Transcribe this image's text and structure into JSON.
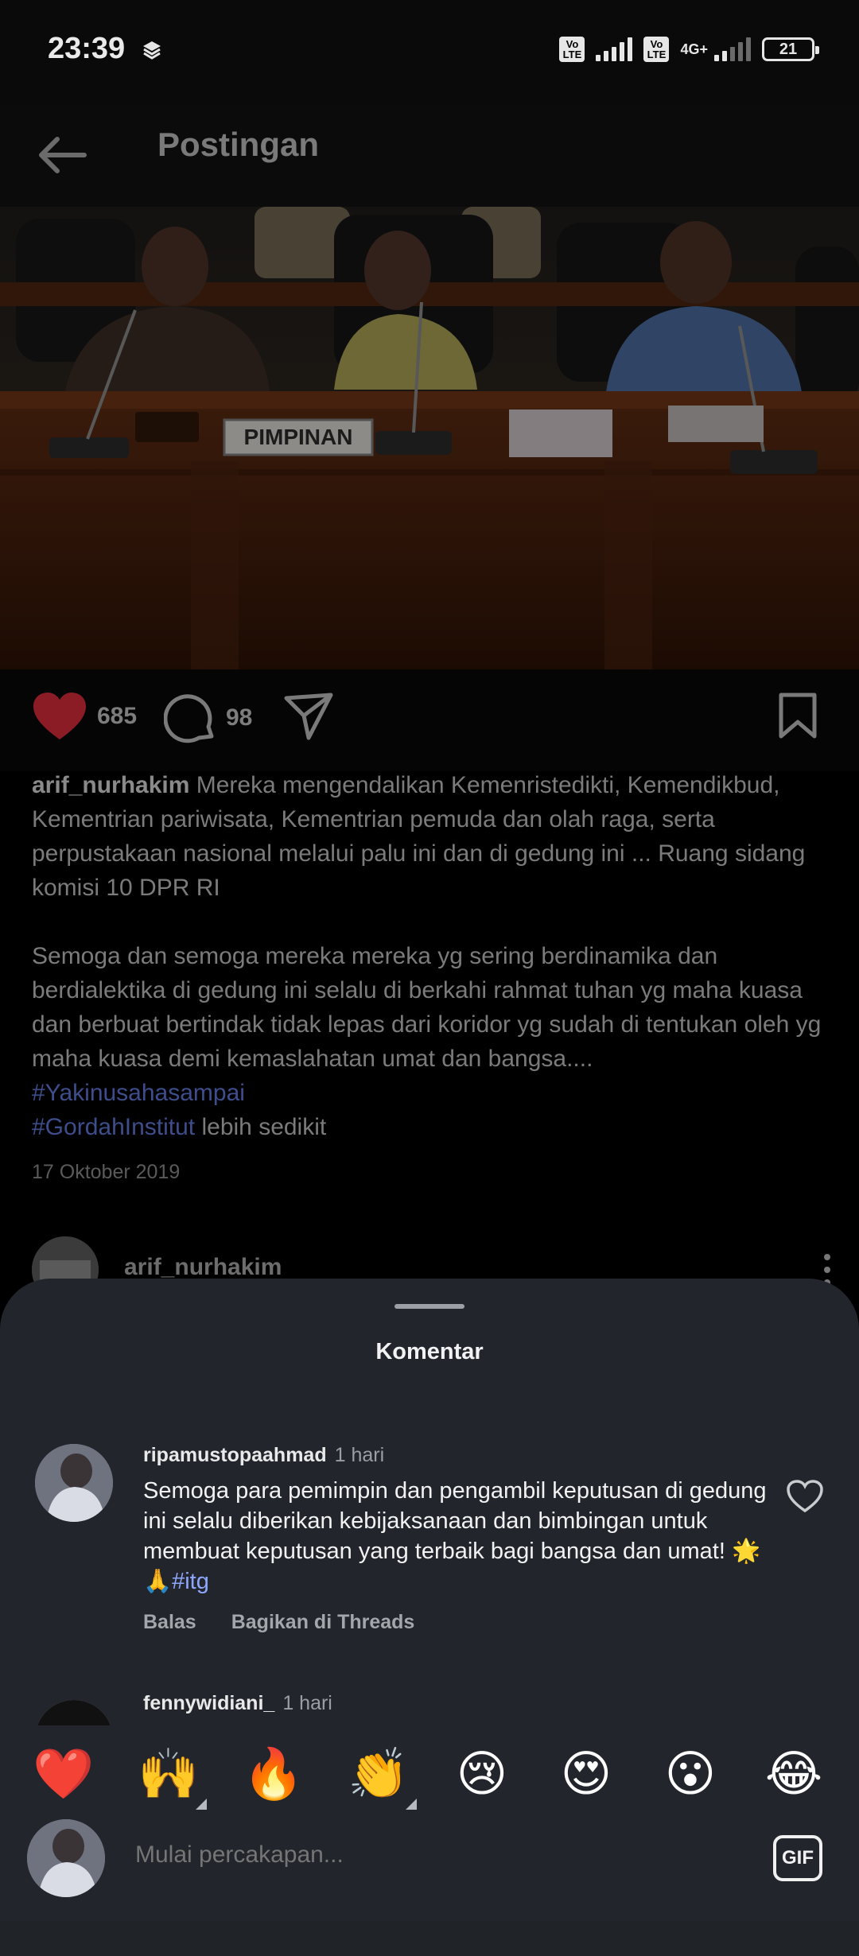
{
  "status_bar": {
    "time": "23:39",
    "sim1_badge": "Vo LTE",
    "sim2_badge": "Vo LTE",
    "network": "4G+",
    "battery": "21"
  },
  "header": {
    "title": "Postingan",
    "back_icon": "arrow-left-icon"
  },
  "post": {
    "image_sign": "PIMPINAN",
    "likes": "685",
    "comments": "98",
    "caption_user": "arif_nurhakim",
    "caption_p1": "Mereka mengendalikan Kemenristedikti, Kemendikbud, Kementrian pariwisata, Kementrian pemuda dan olah raga, serta perpustakaan nasional melalui palu ini dan di gedung ini ... Ruang sidang komisi 10 DPR RI",
    "caption_p2": "Semoga dan semoga mereka mereka yg sering berdinamika dan berdialektika di gedung ini selalu di berkahi rahmat tuhan yg maha kuasa dan berbuat bertindak tidak lepas dari koridor yg sudah di tentukan oleh yg maha kuasa demi kemaslahatan umat dan bangsa....",
    "hashtag1": "#Yakinusahasampai",
    "hashtag2": "#GordahInstitut",
    "more": "lebih sedikit",
    "date": "17 Oktober 2019",
    "author": "arif_nurhakim"
  },
  "sheet": {
    "title": "Komentar",
    "comments": [
      {
        "user": "ripamustopaahmad",
        "time": "1 hari",
        "text": "Semoga para pemimpin dan pengambil keputusan di gedung ini selalu diberikan kebijaksanaan dan bimbingan untuk membuat keputusan yang terbaik bagi bangsa dan umat! 🌟🙏",
        "tag": "#itg",
        "reply": "Balas",
        "share": "Bagikan di Threads"
      },
      {
        "user": "fennywidiani_",
        "time": "1 hari"
      }
    ],
    "emojis": [
      "❤️",
      "🙌",
      "🔥",
      "👏",
      "😢",
      "😍",
      "😮",
      "😂"
    ],
    "composer_placeholder": "Mulai percakapan...",
    "gif_label": "GIF"
  },
  "colors": {
    "sheet_bg": "#22262c",
    "like_red": "#8b1c25",
    "hashtag_blue": "#8fa6ff"
  }
}
